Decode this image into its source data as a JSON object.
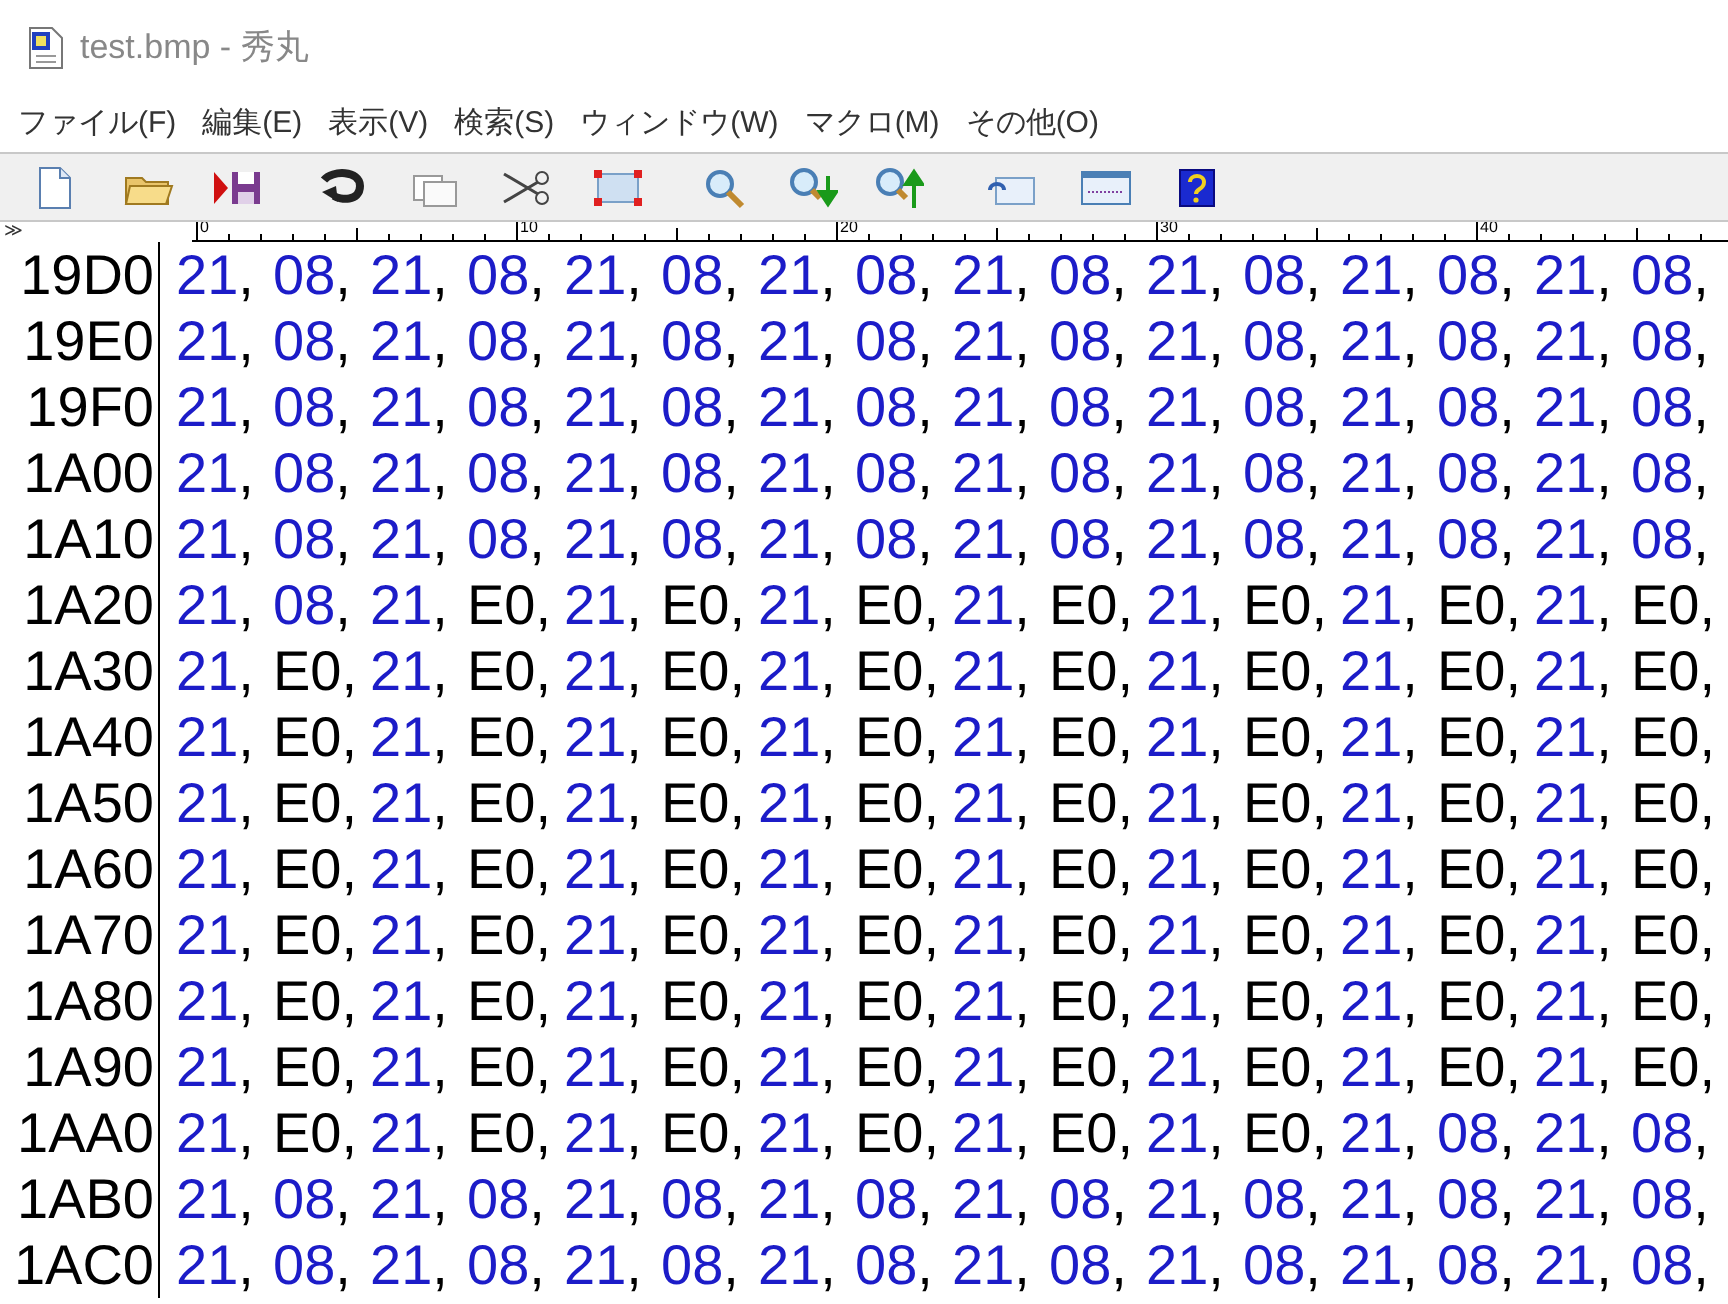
{
  "window": {
    "title": "test.bmp  - 秀丸"
  },
  "menu": [
    "ファイル(F)",
    "編集(E)",
    "表示(V)",
    "検索(S)",
    "ウィンドウ(W)",
    "マクロ(M)",
    "その他(O)"
  ],
  "ruler": {
    "marker": "≫",
    "labels": [
      "0",
      "10",
      "20",
      "30",
      "40"
    ]
  },
  "rows": [
    {
      "address": "19D0",
      "cells": [
        {
          "value": "21",
          "sep": ",",
          "color": "#1c1cc8"
        },
        {
          "value": "08",
          "sep": ",",
          "color": "#1c1cc8"
        },
        {
          "value": "21",
          "sep": ",",
          "color": "#1c1cc8"
        },
        {
          "value": "08",
          "sep": ",",
          "color": "#1c1cc8"
        },
        {
          "value": "21",
          "sep": ",",
          "color": "#1c1cc8"
        },
        {
          "value": "08",
          "sep": ",",
          "color": "#1c1cc8"
        },
        {
          "value": "21",
          "sep": ",",
          "color": "#1c1cc8"
        },
        {
          "value": "08",
          "sep": ",",
          "color": "#1c1cc8"
        },
        {
          "value": "21",
          "sep": ",",
          "color": "#1c1cc8"
        },
        {
          "value": "08",
          "sep": ",",
          "color": "#1c1cc8"
        },
        {
          "value": "21",
          "sep": ",",
          "color": "#1c1cc8"
        },
        {
          "value": "08",
          "sep": ",",
          "color": "#1c1cc8"
        },
        {
          "value": "21",
          "sep": ",",
          "color": "#1c1cc8"
        },
        {
          "value": "08",
          "sep": ",",
          "color": "#1c1cc8"
        },
        {
          "value": "21",
          "sep": ",",
          "color": "#1c1cc8"
        },
        {
          "value": "08",
          "sep": ",",
          "color": "#1c1cc8"
        }
      ]
    },
    {
      "address": "19E0",
      "cells": [
        {
          "value": "21",
          "sep": ",",
          "color": "#1c1cc8"
        },
        {
          "value": "08",
          "sep": ",",
          "color": "#1c1cc8"
        },
        {
          "value": "21",
          "sep": ",",
          "color": "#1c1cc8"
        },
        {
          "value": "08",
          "sep": ",",
          "color": "#1c1cc8"
        },
        {
          "value": "21",
          "sep": ",",
          "color": "#1c1cc8"
        },
        {
          "value": "08",
          "sep": ",",
          "color": "#1c1cc8"
        },
        {
          "value": "21",
          "sep": ",",
          "color": "#1c1cc8"
        },
        {
          "value": "08",
          "sep": ",",
          "color": "#1c1cc8"
        },
        {
          "value": "21",
          "sep": ",",
          "color": "#1c1cc8"
        },
        {
          "value": "08",
          "sep": ",",
          "color": "#1c1cc8"
        },
        {
          "value": "21",
          "sep": ",",
          "color": "#1c1cc8"
        },
        {
          "value": "08",
          "sep": ",",
          "color": "#1c1cc8"
        },
        {
          "value": "21",
          "sep": ",",
          "color": "#1c1cc8"
        },
        {
          "value": "08",
          "sep": ",",
          "color": "#1c1cc8"
        },
        {
          "value": "21",
          "sep": ",",
          "color": "#1c1cc8"
        },
        {
          "value": "08",
          "sep": ",",
          "color": "#1c1cc8"
        }
      ]
    },
    {
      "address": "19F0",
      "cells": [
        {
          "value": "21",
          "sep": ",",
          "color": "#1c1cc8"
        },
        {
          "value": "08",
          "sep": ",",
          "color": "#1c1cc8"
        },
        {
          "value": "21",
          "sep": ",",
          "color": "#1c1cc8"
        },
        {
          "value": "08",
          "sep": ",",
          "color": "#1c1cc8"
        },
        {
          "value": "21",
          "sep": ",",
          "color": "#1c1cc8"
        },
        {
          "value": "08",
          "sep": ",",
          "color": "#1c1cc8"
        },
        {
          "value": "21",
          "sep": ",",
          "color": "#1c1cc8"
        },
        {
          "value": "08",
          "sep": ",",
          "color": "#1c1cc8"
        },
        {
          "value": "21",
          "sep": ",",
          "color": "#1c1cc8"
        },
        {
          "value": "08",
          "sep": ",",
          "color": "#1c1cc8"
        },
        {
          "value": "21",
          "sep": ",",
          "color": "#1c1cc8"
        },
        {
          "value": "08",
          "sep": ",",
          "color": "#1c1cc8"
        },
        {
          "value": "21",
          "sep": ",",
          "color": "#1c1cc8"
        },
        {
          "value": "08",
          "sep": ",",
          "color": "#1c1cc8"
        },
        {
          "value": "21",
          "sep": ",",
          "color": "#1c1cc8"
        },
        {
          "value": "08",
          "sep": ",",
          "color": "#1c1cc8"
        }
      ]
    },
    {
      "address": "1A00",
      "cells": [
        {
          "value": "21",
          "sep": ",",
          "color": "#1c1cc8"
        },
        {
          "value": "08",
          "sep": ",",
          "color": "#1c1cc8"
        },
        {
          "value": "21",
          "sep": ",",
          "color": "#1c1cc8"
        },
        {
          "value": "08",
          "sep": ",",
          "color": "#1c1cc8"
        },
        {
          "value": "21",
          "sep": ",",
          "color": "#1c1cc8"
        },
        {
          "value": "08",
          "sep": ",",
          "color": "#1c1cc8"
        },
        {
          "value": "21",
          "sep": ",",
          "color": "#1c1cc8"
        },
        {
          "value": "08",
          "sep": ",",
          "color": "#1c1cc8"
        },
        {
          "value": "21",
          "sep": ",",
          "color": "#1c1cc8"
        },
        {
          "value": "08",
          "sep": ",",
          "color": "#1c1cc8"
        },
        {
          "value": "21",
          "sep": ",",
          "color": "#1c1cc8"
        },
        {
          "value": "08",
          "sep": ",",
          "color": "#1c1cc8"
        },
        {
          "value": "21",
          "sep": ",",
          "color": "#1c1cc8"
        },
        {
          "value": "08",
          "sep": ",",
          "color": "#1c1cc8"
        },
        {
          "value": "21",
          "sep": ",",
          "color": "#1c1cc8"
        },
        {
          "value": "08",
          "sep": ",",
          "color": "#1c1cc8"
        }
      ]
    },
    {
      "address": "1A10",
      "cells": [
        {
          "value": "21",
          "sep": ",",
          "color": "#1c1cc8"
        },
        {
          "value": "08",
          "sep": ",",
          "color": "#1c1cc8"
        },
        {
          "value": "21",
          "sep": ",",
          "color": "#1c1cc8"
        },
        {
          "value": "08",
          "sep": ",",
          "color": "#1c1cc8"
        },
        {
          "value": "21",
          "sep": ",",
          "color": "#1c1cc8"
        },
        {
          "value": "08",
          "sep": ",",
          "color": "#1c1cc8"
        },
        {
          "value": "21",
          "sep": ",",
          "color": "#1c1cc8"
        },
        {
          "value": "08",
          "sep": ",",
          "color": "#1c1cc8"
        },
        {
          "value": "21",
          "sep": ",",
          "color": "#1c1cc8"
        },
        {
          "value": "08",
          "sep": ",",
          "color": "#1c1cc8"
        },
        {
          "value": "21",
          "sep": ",",
          "color": "#1c1cc8"
        },
        {
          "value": "08",
          "sep": ",",
          "color": "#1c1cc8"
        },
        {
          "value": "21",
          "sep": ",",
          "color": "#1c1cc8"
        },
        {
          "value": "08",
          "sep": ",",
          "color": "#1c1cc8"
        },
        {
          "value": "21",
          "sep": ",",
          "color": "#1c1cc8"
        },
        {
          "value": "08",
          "sep": ",",
          "color": "#1c1cc8"
        }
      ]
    },
    {
      "address": "1A20",
      "cells": [
        {
          "value": "21",
          "sep": ",",
          "color": "#1c1cc8"
        },
        {
          "value": "08",
          "sep": ",",
          "color": "#1c1cc8"
        },
        {
          "value": "21",
          "sep": ",",
          "color": "#1c1cc8"
        },
        {
          "value": "E0",
          "sep": ",",
          "color": "#000000"
        },
        {
          "value": "21",
          "sep": ",",
          "color": "#1c1cc8"
        },
        {
          "value": "E0",
          "sep": ",",
          "color": "#000000"
        },
        {
          "value": "21",
          "sep": ",",
          "color": "#1c1cc8"
        },
        {
          "value": "E0",
          "sep": ",",
          "color": "#000000"
        },
        {
          "value": "21",
          "sep": ",",
          "color": "#1c1cc8"
        },
        {
          "value": "E0",
          "sep": ",",
          "color": "#000000"
        },
        {
          "value": "21",
          "sep": ",",
          "color": "#1c1cc8"
        },
        {
          "value": "E0",
          "sep": ",",
          "color": "#000000"
        },
        {
          "value": "21",
          "sep": ",",
          "color": "#1c1cc8"
        },
        {
          "value": "E0",
          "sep": ",",
          "color": "#000000"
        },
        {
          "value": "21",
          "sep": ",",
          "color": "#1c1cc8"
        },
        {
          "value": "E0",
          "sep": ",",
          "color": "#000000"
        }
      ]
    },
    {
      "address": "1A30",
      "cells": [
        {
          "value": "21",
          "sep": ",",
          "color": "#1c1cc8"
        },
        {
          "value": "E0",
          "sep": ",",
          "color": "#000000"
        },
        {
          "value": "21",
          "sep": ",",
          "color": "#1c1cc8"
        },
        {
          "value": "E0",
          "sep": ",",
          "color": "#000000"
        },
        {
          "value": "21",
          "sep": ",",
          "color": "#1c1cc8"
        },
        {
          "value": "E0",
          "sep": ",",
          "color": "#000000"
        },
        {
          "value": "21",
          "sep": ",",
          "color": "#1c1cc8"
        },
        {
          "value": "E0",
          "sep": ",",
          "color": "#000000"
        },
        {
          "value": "21",
          "sep": ",",
          "color": "#1c1cc8"
        },
        {
          "value": "E0",
          "sep": ",",
          "color": "#000000"
        },
        {
          "value": "21",
          "sep": ",",
          "color": "#1c1cc8"
        },
        {
          "value": "E0",
          "sep": ",",
          "color": "#000000"
        },
        {
          "value": "21",
          "sep": ",",
          "color": "#1c1cc8"
        },
        {
          "value": "E0",
          "sep": ",",
          "color": "#000000"
        },
        {
          "value": "21",
          "sep": ",",
          "color": "#1c1cc8"
        },
        {
          "value": "E0",
          "sep": ",",
          "color": "#000000"
        }
      ]
    },
    {
      "address": "1A40",
      "cells": [
        {
          "value": "21",
          "sep": ",",
          "color": "#1c1cc8"
        },
        {
          "value": "E0",
          "sep": ",",
          "color": "#000000"
        },
        {
          "value": "21",
          "sep": ",",
          "color": "#1c1cc8"
        },
        {
          "value": "E0",
          "sep": ",",
          "color": "#000000"
        },
        {
          "value": "21",
          "sep": ",",
          "color": "#1c1cc8"
        },
        {
          "value": "E0",
          "sep": ",",
          "color": "#000000"
        },
        {
          "value": "21",
          "sep": ",",
          "color": "#1c1cc8"
        },
        {
          "value": "E0",
          "sep": ",",
          "color": "#000000"
        },
        {
          "value": "21",
          "sep": ",",
          "color": "#1c1cc8"
        },
        {
          "value": "E0",
          "sep": ",",
          "color": "#000000"
        },
        {
          "value": "21",
          "sep": ",",
          "color": "#1c1cc8"
        },
        {
          "value": "E0",
          "sep": ",",
          "color": "#000000"
        },
        {
          "value": "21",
          "sep": ",",
          "color": "#1c1cc8"
        },
        {
          "value": "E0",
          "sep": ",",
          "color": "#000000"
        },
        {
          "value": "21",
          "sep": ",",
          "color": "#1c1cc8"
        },
        {
          "value": "E0",
          "sep": ",",
          "color": "#000000"
        }
      ]
    },
    {
      "address": "1A50",
      "cells": [
        {
          "value": "21",
          "sep": ",",
          "color": "#1c1cc8"
        },
        {
          "value": "E0",
          "sep": ",",
          "color": "#000000"
        },
        {
          "value": "21",
          "sep": ",",
          "color": "#1c1cc8"
        },
        {
          "value": "E0",
          "sep": ",",
          "color": "#000000"
        },
        {
          "value": "21",
          "sep": ",",
          "color": "#1c1cc8"
        },
        {
          "value": "E0",
          "sep": ",",
          "color": "#000000"
        },
        {
          "value": "21",
          "sep": ",",
          "color": "#1c1cc8"
        },
        {
          "value": "E0",
          "sep": ",",
          "color": "#000000"
        },
        {
          "value": "21",
          "sep": ",",
          "color": "#1c1cc8"
        },
        {
          "value": "E0",
          "sep": ",",
          "color": "#000000"
        },
        {
          "value": "21",
          "sep": ",",
          "color": "#1c1cc8"
        },
        {
          "value": "E0",
          "sep": ",",
          "color": "#000000"
        },
        {
          "value": "21",
          "sep": ",",
          "color": "#1c1cc8"
        },
        {
          "value": "E0",
          "sep": ",",
          "color": "#000000"
        },
        {
          "value": "21",
          "sep": ",",
          "color": "#1c1cc8"
        },
        {
          "value": "E0",
          "sep": ",",
          "color": "#000000"
        }
      ]
    },
    {
      "address": "1A60",
      "cells": [
        {
          "value": "21",
          "sep": ",",
          "color": "#1c1cc8"
        },
        {
          "value": "E0",
          "sep": ",",
          "color": "#000000"
        },
        {
          "value": "21",
          "sep": ",",
          "color": "#1c1cc8"
        },
        {
          "value": "E0",
          "sep": ",",
          "color": "#000000"
        },
        {
          "value": "21",
          "sep": ",",
          "color": "#1c1cc8"
        },
        {
          "value": "E0",
          "sep": ",",
          "color": "#000000"
        },
        {
          "value": "21",
          "sep": ",",
          "color": "#1c1cc8"
        },
        {
          "value": "E0",
          "sep": ",",
          "color": "#000000"
        },
        {
          "value": "21",
          "sep": ",",
          "color": "#1c1cc8"
        },
        {
          "value": "E0",
          "sep": ",",
          "color": "#000000"
        },
        {
          "value": "21",
          "sep": ",",
          "color": "#1c1cc8"
        },
        {
          "value": "E0",
          "sep": ",",
          "color": "#000000"
        },
        {
          "value": "21",
          "sep": ",",
          "color": "#1c1cc8"
        },
        {
          "value": "E0",
          "sep": ",",
          "color": "#000000"
        },
        {
          "value": "21",
          "sep": ",",
          "color": "#1c1cc8"
        },
        {
          "value": "E0",
          "sep": ",",
          "color": "#000000"
        }
      ]
    },
    {
      "address": "1A70",
      "cells": [
        {
          "value": "21",
          "sep": ",",
          "color": "#1c1cc8"
        },
        {
          "value": "E0",
          "sep": ",",
          "color": "#000000"
        },
        {
          "value": "21",
          "sep": ",",
          "color": "#1c1cc8"
        },
        {
          "value": "E0",
          "sep": ",",
          "color": "#000000"
        },
        {
          "value": "21",
          "sep": ",",
          "color": "#1c1cc8"
        },
        {
          "value": "E0",
          "sep": ",",
          "color": "#000000"
        },
        {
          "value": "21",
          "sep": ",",
          "color": "#1c1cc8"
        },
        {
          "value": "E0",
          "sep": ",",
          "color": "#000000"
        },
        {
          "value": "21",
          "sep": ",",
          "color": "#1c1cc8"
        },
        {
          "value": "E0",
          "sep": ",",
          "color": "#000000"
        },
        {
          "value": "21",
          "sep": ",",
          "color": "#1c1cc8"
        },
        {
          "value": "E0",
          "sep": ",",
          "color": "#000000"
        },
        {
          "value": "21",
          "sep": ",",
          "color": "#1c1cc8"
        },
        {
          "value": "E0",
          "sep": ",",
          "color": "#000000"
        },
        {
          "value": "21",
          "sep": ",",
          "color": "#1c1cc8"
        },
        {
          "value": "E0",
          "sep": ",",
          "color": "#000000"
        }
      ]
    },
    {
      "address": "1A80",
      "cells": [
        {
          "value": "21",
          "sep": ",",
          "color": "#1c1cc8"
        },
        {
          "value": "E0",
          "sep": ",",
          "color": "#000000"
        },
        {
          "value": "21",
          "sep": ",",
          "color": "#1c1cc8"
        },
        {
          "value": "E0",
          "sep": ",",
          "color": "#000000"
        },
        {
          "value": "21",
          "sep": ",",
          "color": "#1c1cc8"
        },
        {
          "value": "E0",
          "sep": ",",
          "color": "#000000"
        },
        {
          "value": "21",
          "sep": ",",
          "color": "#1c1cc8"
        },
        {
          "value": "E0",
          "sep": ",",
          "color": "#000000"
        },
        {
          "value": "21",
          "sep": ",",
          "color": "#1c1cc8"
        },
        {
          "value": "E0",
          "sep": ",",
          "color": "#000000"
        },
        {
          "value": "21",
          "sep": ",",
          "color": "#1c1cc8"
        },
        {
          "value": "E0",
          "sep": ",",
          "color": "#000000"
        },
        {
          "value": "21",
          "sep": ",",
          "color": "#1c1cc8"
        },
        {
          "value": "E0",
          "sep": ",",
          "color": "#000000"
        },
        {
          "value": "21",
          "sep": ",",
          "color": "#1c1cc8"
        },
        {
          "value": "E0",
          "sep": ",",
          "color": "#000000"
        }
      ]
    },
    {
      "address": "1A90",
      "cells": [
        {
          "value": "21",
          "sep": ",",
          "color": "#1c1cc8"
        },
        {
          "value": "E0",
          "sep": ",",
          "color": "#000000"
        },
        {
          "value": "21",
          "sep": ",",
          "color": "#1c1cc8"
        },
        {
          "value": "E0",
          "sep": ",",
          "color": "#000000"
        },
        {
          "value": "21",
          "sep": ",",
          "color": "#1c1cc8"
        },
        {
          "value": "E0",
          "sep": ",",
          "color": "#000000"
        },
        {
          "value": "21",
          "sep": ",",
          "color": "#1c1cc8"
        },
        {
          "value": "E0",
          "sep": ",",
          "color": "#000000"
        },
        {
          "value": "21",
          "sep": ",",
          "color": "#1c1cc8"
        },
        {
          "value": "E0",
          "sep": ",",
          "color": "#000000"
        },
        {
          "value": "21",
          "sep": ",",
          "color": "#1c1cc8"
        },
        {
          "value": "E0",
          "sep": ",",
          "color": "#000000"
        },
        {
          "value": "21",
          "sep": ",",
          "color": "#1c1cc8"
        },
        {
          "value": "E0",
          "sep": ",",
          "color": "#000000"
        },
        {
          "value": "21",
          "sep": ",",
          "color": "#1c1cc8"
        },
        {
          "value": "E0",
          "sep": ",",
          "color": "#000000"
        }
      ]
    },
    {
      "address": "1AA0",
      "cells": [
        {
          "value": "21",
          "sep": ",",
          "color": "#1c1cc8"
        },
        {
          "value": "E0",
          "sep": ",",
          "color": "#000000"
        },
        {
          "value": "21",
          "sep": ",",
          "color": "#1c1cc8"
        },
        {
          "value": "E0",
          "sep": ",",
          "color": "#000000"
        },
        {
          "value": "21",
          "sep": ",",
          "color": "#1c1cc8"
        },
        {
          "value": "E0",
          "sep": ",",
          "color": "#000000"
        },
        {
          "value": "21",
          "sep": ",",
          "color": "#1c1cc8"
        },
        {
          "value": "E0",
          "sep": ",",
          "color": "#000000"
        },
        {
          "value": "21",
          "sep": ",",
          "color": "#1c1cc8"
        },
        {
          "value": "E0",
          "sep": ",",
          "color": "#000000"
        },
        {
          "value": "21",
          "sep": ",",
          "color": "#1c1cc8"
        },
        {
          "value": "E0",
          "sep": ",",
          "color": "#000000"
        },
        {
          "value": "21",
          "sep": ",",
          "color": "#1c1cc8"
        },
        {
          "value": "08",
          "sep": ",",
          "color": "#1c1cc8"
        },
        {
          "value": "21",
          "sep": ",",
          "color": "#1c1cc8"
        },
        {
          "value": "08",
          "sep": ",",
          "color": "#1c1cc8"
        }
      ]
    },
    {
      "address": "1AB0",
      "cells": [
        {
          "value": "21",
          "sep": ",",
          "color": "#1c1cc8"
        },
        {
          "value": "08",
          "sep": ",",
          "color": "#1c1cc8"
        },
        {
          "value": "21",
          "sep": ",",
          "color": "#1c1cc8"
        },
        {
          "value": "08",
          "sep": ",",
          "color": "#1c1cc8"
        },
        {
          "value": "21",
          "sep": ",",
          "color": "#1c1cc8"
        },
        {
          "value": "08",
          "sep": ",",
          "color": "#1c1cc8"
        },
        {
          "value": "21",
          "sep": ",",
          "color": "#1c1cc8"
        },
        {
          "value": "08",
          "sep": ",",
          "color": "#1c1cc8"
        },
        {
          "value": "21",
          "sep": ",",
          "color": "#1c1cc8"
        },
        {
          "value": "08",
          "sep": ",",
          "color": "#1c1cc8"
        },
        {
          "value": "21",
          "sep": ",",
          "color": "#1c1cc8"
        },
        {
          "value": "08",
          "sep": ",",
          "color": "#1c1cc8"
        },
        {
          "value": "21",
          "sep": ",",
          "color": "#1c1cc8"
        },
        {
          "value": "08",
          "sep": ",",
          "color": "#1c1cc8"
        },
        {
          "value": "21",
          "sep": ",",
          "color": "#1c1cc8"
        },
        {
          "value": "08",
          "sep": ",",
          "color": "#1c1cc8"
        }
      ]
    },
    {
      "address": "1AC0",
      "cells": [
        {
          "value": "21",
          "sep": ",",
          "color": "#1c1cc8"
        },
        {
          "value": "08",
          "sep": ",",
          "color": "#1c1cc8"
        },
        {
          "value": "21",
          "sep": ",",
          "color": "#1c1cc8"
        },
        {
          "value": "08",
          "sep": ",",
          "color": "#1c1cc8"
        },
        {
          "value": "21",
          "sep": ",",
          "color": "#1c1cc8"
        },
        {
          "value": "08",
          "sep": ",",
          "color": "#1c1cc8"
        },
        {
          "value": "21",
          "sep": ",",
          "color": "#1c1cc8"
        },
        {
          "value": "08",
          "sep": ",",
          "color": "#1c1cc8"
        },
        {
          "value": "21",
          "sep": ",",
          "color": "#1c1cc8"
        },
        {
          "value": "08",
          "sep": ",",
          "color": "#1c1cc8"
        },
        {
          "value": "21",
          "sep": ",",
          "color": "#1c1cc8"
        },
        {
          "value": "08",
          "sep": ",",
          "color": "#1c1cc8"
        },
        {
          "value": "21",
          "sep": ",",
          "color": "#1c1cc8"
        },
        {
          "value": "08",
          "sep": ",",
          "color": "#1c1cc8"
        },
        {
          "value": "21",
          "sep": ",",
          "color": "#1c1cc8"
        },
        {
          "value": "08",
          "sep": ",",
          "color": "#1c1cc8"
        }
      ]
    }
  ]
}
